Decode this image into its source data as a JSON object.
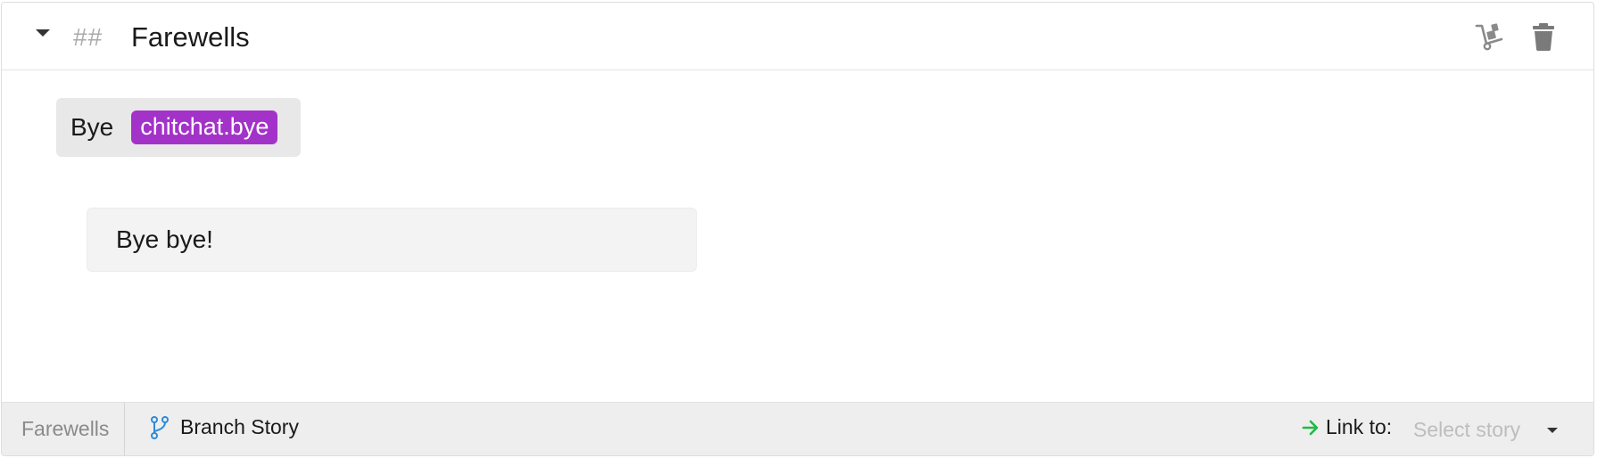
{
  "story": {
    "heading_prefix": "##",
    "title": "Farewells"
  },
  "header": {
    "icons": [
      "chevron-down-icon",
      "dolly-icon",
      "trash-icon"
    ]
  },
  "user_step": {
    "text": "Bye",
    "intent": "chitchat.bye",
    "intent_color": "#a333c8"
  },
  "bot_step": {
    "text": "Bye bye!"
  },
  "footer": {
    "story_name": "Farewells",
    "branch_label": "Branch Story",
    "link_label": "Link to:",
    "select_placeholder": "Select story",
    "icons": [
      "branch-icon",
      "arrow-right-icon",
      "caret-down-icon"
    ],
    "colors": {
      "branch_icon": "#2e8bd8",
      "link_arrow": "#21ba45"
    }
  }
}
